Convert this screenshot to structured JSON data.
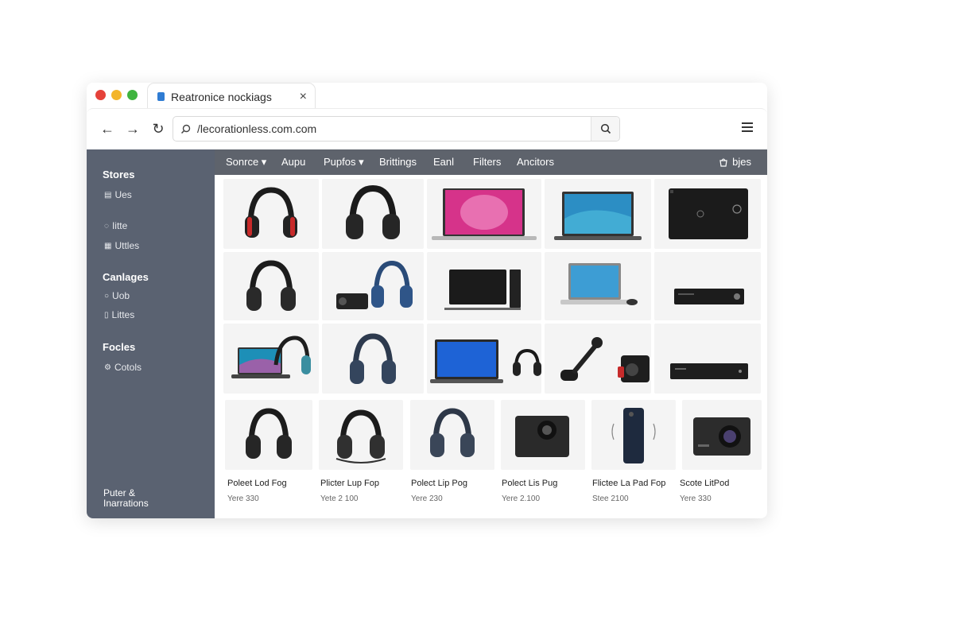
{
  "tab": {
    "title": "Reatronice nockiags",
    "close": "×"
  },
  "toolbar": {
    "back": "←",
    "forward": "→",
    "reload": "↻",
    "url": "/lecorationless.com.com"
  },
  "sidebar": {
    "sections": [
      {
        "title": "Stores",
        "items": [
          "Ues"
        ]
      },
      {
        "title": "",
        "items": [
          "Iitte",
          "Uttles"
        ]
      },
      {
        "title": "Canlages",
        "items": [
          "Uob",
          "Littes"
        ]
      },
      {
        "title": "Focles",
        "items": [
          "Cotols"
        ]
      }
    ],
    "footer_line1": "Puter &",
    "footer_line2": "Inarrations"
  },
  "categories": {
    "items": [
      "Sonrce ▾",
      "Aupu",
      "Pupfos ▾",
      "Brittings",
      "Eanl",
      "Filters",
      "Ancitors"
    ],
    "right_label": "bjes"
  },
  "products": [
    {
      "title": "Poleet Lod Fog",
      "price": "Yere 330"
    },
    {
      "title": "Plicter Lup Fop",
      "price": "Yete 2 100"
    },
    {
      "title": "Polect Lip Pog",
      "price": "Yere 230"
    },
    {
      "title": "Polect Lis Pug",
      "price": "Yere 2.100"
    },
    {
      "title": "Flictee La Pad Fop",
      "price": "Stee 2100"
    },
    {
      "title": "Scote LitPod",
      "price": "Yere 330"
    }
  ],
  "colors": {
    "sidebar": "#5a6271",
    "category_bar": "#5e636c",
    "accent": "#2f7cd3"
  }
}
